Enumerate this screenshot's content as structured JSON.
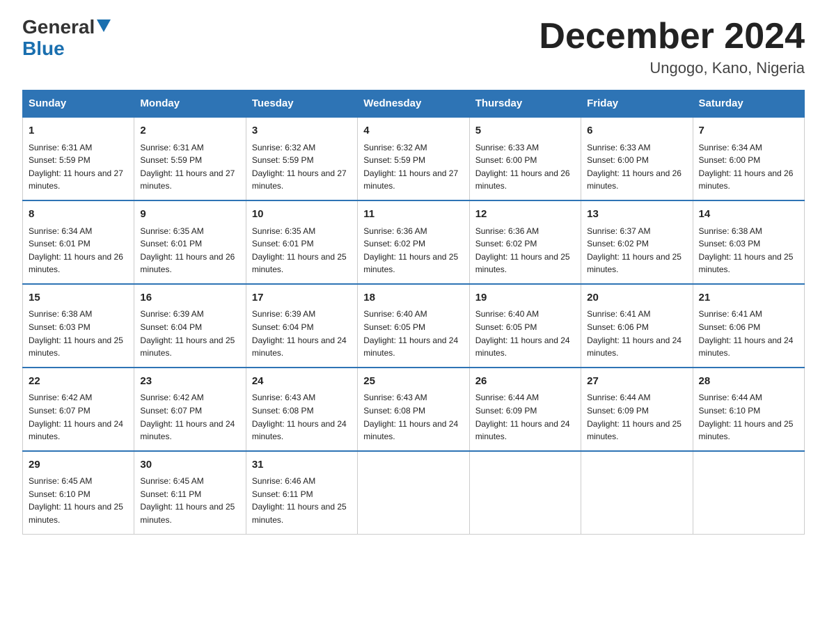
{
  "logo": {
    "general": "General",
    "blue": "Blue"
  },
  "title": "December 2024",
  "location": "Ungogo, Kano, Nigeria",
  "days_of_week": [
    "Sunday",
    "Monday",
    "Tuesday",
    "Wednesday",
    "Thursday",
    "Friday",
    "Saturday"
  ],
  "weeks": [
    [
      {
        "num": "1",
        "sunrise": "6:31 AM",
        "sunset": "5:59 PM",
        "daylight": "11 hours and 27 minutes."
      },
      {
        "num": "2",
        "sunrise": "6:31 AM",
        "sunset": "5:59 PM",
        "daylight": "11 hours and 27 minutes."
      },
      {
        "num": "3",
        "sunrise": "6:32 AM",
        "sunset": "5:59 PM",
        "daylight": "11 hours and 27 minutes."
      },
      {
        "num": "4",
        "sunrise": "6:32 AM",
        "sunset": "5:59 PM",
        "daylight": "11 hours and 27 minutes."
      },
      {
        "num": "5",
        "sunrise": "6:33 AM",
        "sunset": "6:00 PM",
        "daylight": "11 hours and 26 minutes."
      },
      {
        "num": "6",
        "sunrise": "6:33 AM",
        "sunset": "6:00 PM",
        "daylight": "11 hours and 26 minutes."
      },
      {
        "num": "7",
        "sunrise": "6:34 AM",
        "sunset": "6:00 PM",
        "daylight": "11 hours and 26 minutes."
      }
    ],
    [
      {
        "num": "8",
        "sunrise": "6:34 AM",
        "sunset": "6:01 PM",
        "daylight": "11 hours and 26 minutes."
      },
      {
        "num": "9",
        "sunrise": "6:35 AM",
        "sunset": "6:01 PM",
        "daylight": "11 hours and 26 minutes."
      },
      {
        "num": "10",
        "sunrise": "6:35 AM",
        "sunset": "6:01 PM",
        "daylight": "11 hours and 25 minutes."
      },
      {
        "num": "11",
        "sunrise": "6:36 AM",
        "sunset": "6:02 PM",
        "daylight": "11 hours and 25 minutes."
      },
      {
        "num": "12",
        "sunrise": "6:36 AM",
        "sunset": "6:02 PM",
        "daylight": "11 hours and 25 minutes."
      },
      {
        "num": "13",
        "sunrise": "6:37 AM",
        "sunset": "6:02 PM",
        "daylight": "11 hours and 25 minutes."
      },
      {
        "num": "14",
        "sunrise": "6:38 AM",
        "sunset": "6:03 PM",
        "daylight": "11 hours and 25 minutes."
      }
    ],
    [
      {
        "num": "15",
        "sunrise": "6:38 AM",
        "sunset": "6:03 PM",
        "daylight": "11 hours and 25 minutes."
      },
      {
        "num": "16",
        "sunrise": "6:39 AM",
        "sunset": "6:04 PM",
        "daylight": "11 hours and 25 minutes."
      },
      {
        "num": "17",
        "sunrise": "6:39 AM",
        "sunset": "6:04 PM",
        "daylight": "11 hours and 24 minutes."
      },
      {
        "num": "18",
        "sunrise": "6:40 AM",
        "sunset": "6:05 PM",
        "daylight": "11 hours and 24 minutes."
      },
      {
        "num": "19",
        "sunrise": "6:40 AM",
        "sunset": "6:05 PM",
        "daylight": "11 hours and 24 minutes."
      },
      {
        "num": "20",
        "sunrise": "6:41 AM",
        "sunset": "6:06 PM",
        "daylight": "11 hours and 24 minutes."
      },
      {
        "num": "21",
        "sunrise": "6:41 AM",
        "sunset": "6:06 PM",
        "daylight": "11 hours and 24 minutes."
      }
    ],
    [
      {
        "num": "22",
        "sunrise": "6:42 AM",
        "sunset": "6:07 PM",
        "daylight": "11 hours and 24 minutes."
      },
      {
        "num": "23",
        "sunrise": "6:42 AM",
        "sunset": "6:07 PM",
        "daylight": "11 hours and 24 minutes."
      },
      {
        "num": "24",
        "sunrise": "6:43 AM",
        "sunset": "6:08 PM",
        "daylight": "11 hours and 24 minutes."
      },
      {
        "num": "25",
        "sunrise": "6:43 AM",
        "sunset": "6:08 PM",
        "daylight": "11 hours and 24 minutes."
      },
      {
        "num": "26",
        "sunrise": "6:44 AM",
        "sunset": "6:09 PM",
        "daylight": "11 hours and 24 minutes."
      },
      {
        "num": "27",
        "sunrise": "6:44 AM",
        "sunset": "6:09 PM",
        "daylight": "11 hours and 25 minutes."
      },
      {
        "num": "28",
        "sunrise": "6:44 AM",
        "sunset": "6:10 PM",
        "daylight": "11 hours and 25 minutes."
      }
    ],
    [
      {
        "num": "29",
        "sunrise": "6:45 AM",
        "sunset": "6:10 PM",
        "daylight": "11 hours and 25 minutes."
      },
      {
        "num": "30",
        "sunrise": "6:45 AM",
        "sunset": "6:11 PM",
        "daylight": "11 hours and 25 minutes."
      },
      {
        "num": "31",
        "sunrise": "6:46 AM",
        "sunset": "6:11 PM",
        "daylight": "11 hours and 25 minutes."
      },
      null,
      null,
      null,
      null
    ]
  ],
  "labels": {
    "sunrise": "Sunrise:",
    "sunset": "Sunset:",
    "daylight": "Daylight:"
  }
}
